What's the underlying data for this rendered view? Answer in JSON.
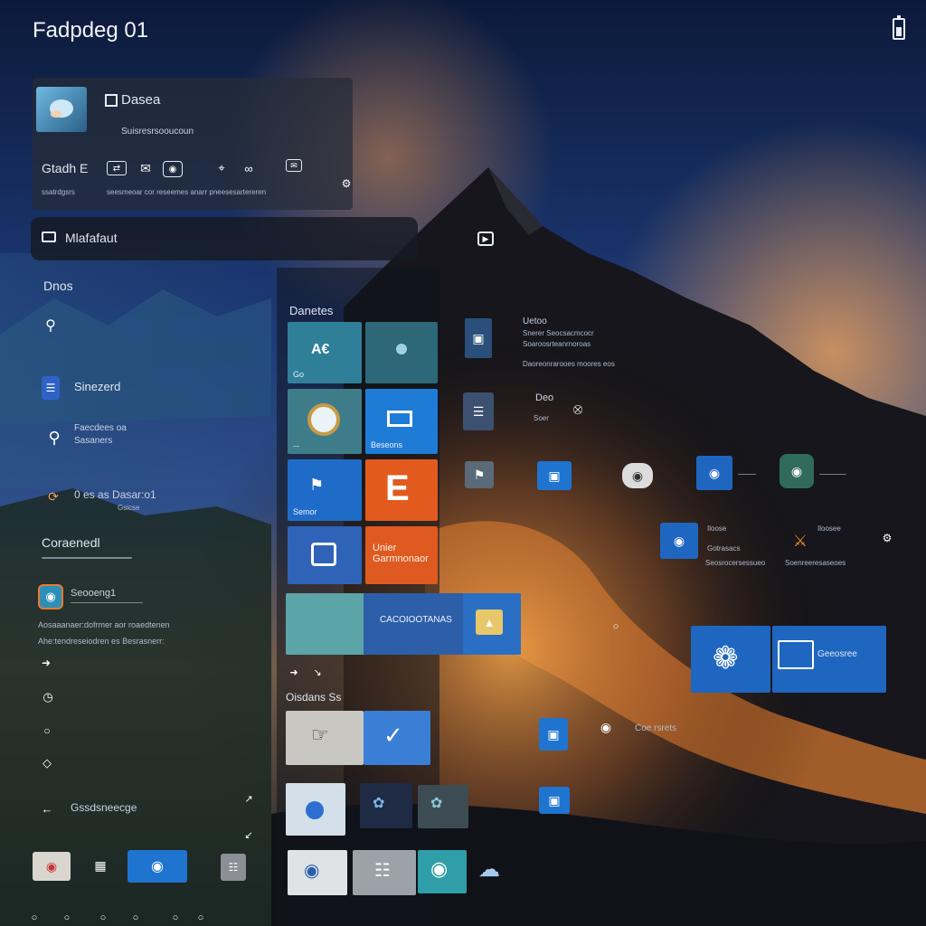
{
  "app": {
    "title": "Fadpdeg 01",
    "corner_icon": "battery-icon"
  },
  "header_card": {
    "title": "Dasea",
    "subtitle": "Suisresrsooucoun",
    "row_label": "Gtadh E",
    "row_sub": "ssatrdgsrs",
    "row_caption": "seesmeoar cor reseemes anarr pneesesartereren"
  },
  "search_bar": {
    "label": "Mlafafaut"
  },
  "left_pane": {
    "section1": "Dnos",
    "item_search": "Sinezerd",
    "item_recent_title": "Faecdees oa",
    "item_recent_sub": "Sasaners",
    "item_hist_title": "0 es as  Dasar:o1",
    "item_hist_sub": "Gsicse",
    "section2": "Coraenedl",
    "app_title": "Seooeng1",
    "app_line1": "Aosaaanaer:dofrmer aor roaedtenen",
    "app_line2": "Ahe:tendreseiodren es Besrasnerr:",
    "footer_label": "Gssdsneecge"
  },
  "start": {
    "group_title": "Danetes",
    "tiles": {
      "t1": "A€",
      "t1_sub": "Go",
      "t4_sub": "Beseons",
      "t5_sub": "Semor",
      "t6": "E",
      "t8": "Unier Garmnonaor",
      "wide_label": "CACOIOOTANAS"
    },
    "group2_title": "Oisdans Ss",
    "icon_labels": [
      "ae"
    ]
  },
  "right": {
    "info1_title": "Uetoo",
    "info1_lines": [
      "Snerer Seocsacmcocr",
      "Soaroosrteanrnoroas",
      "Daoreonrarooes moores eos"
    ],
    "info2_title": "Deo",
    "info2_sub": "Soer",
    "card1_title": "Iloose",
    "card1_lines": [
      "Gotrasacs",
      "Seosrocersessueo"
    ],
    "card2_title": "Iloosee",
    "card2_lines": [
      "Soenreeresaseoes"
    ],
    "blue_wide_label": "Geeosree",
    "flow_label": "Coe rsrets"
  },
  "colors": {
    "tile_blue": "#1f6fd1",
    "tile_teal": "#2f6c80",
    "tile_orange": "#e05a1c",
    "panel": "#2a303c"
  }
}
